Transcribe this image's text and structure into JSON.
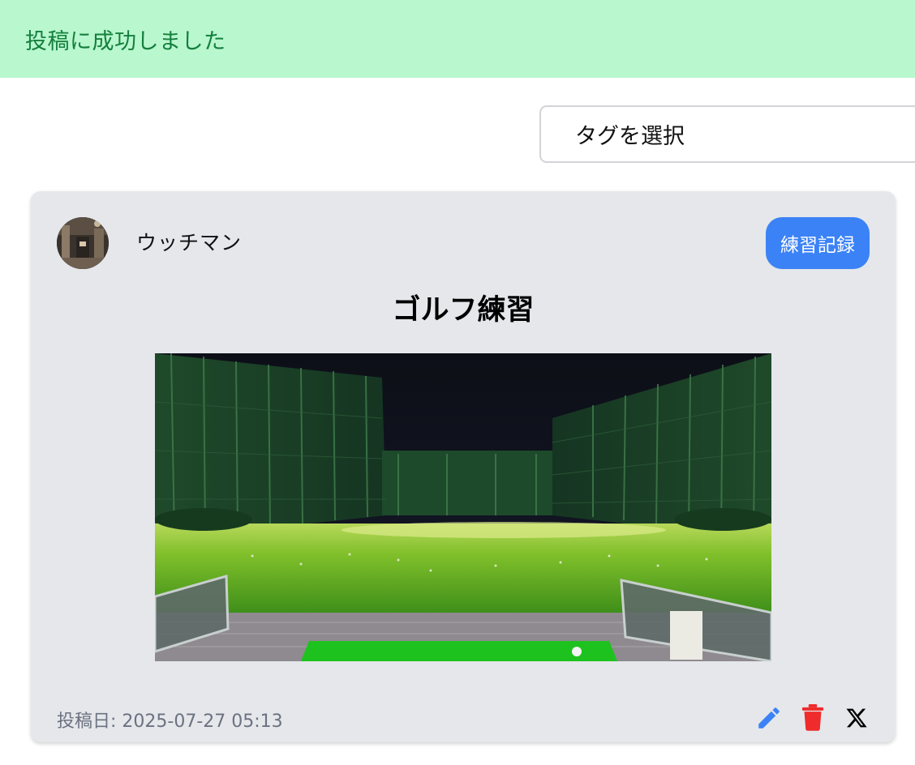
{
  "flash": {
    "message": "投稿に成功しました"
  },
  "filter": {
    "tag_select_label": "タグを選択"
  },
  "post": {
    "username": "ウッチマン",
    "category": "練習記録",
    "title": "ゴルフ練習",
    "date": "投稿日: 2025-07-27 05:13",
    "actions": {
      "edit_icon": "pencil-icon",
      "delete_icon": "trash-icon",
      "share_icon": "x-logo-icon"
    }
  },
  "colors": {
    "flash_bg": "#b9f7cf",
    "flash_text": "#15803d",
    "badge_bg": "#3b82f6",
    "edit_icon": "#3b82f6",
    "delete_icon": "#ef2b2b",
    "card_bg": "#e5e7eb"
  }
}
